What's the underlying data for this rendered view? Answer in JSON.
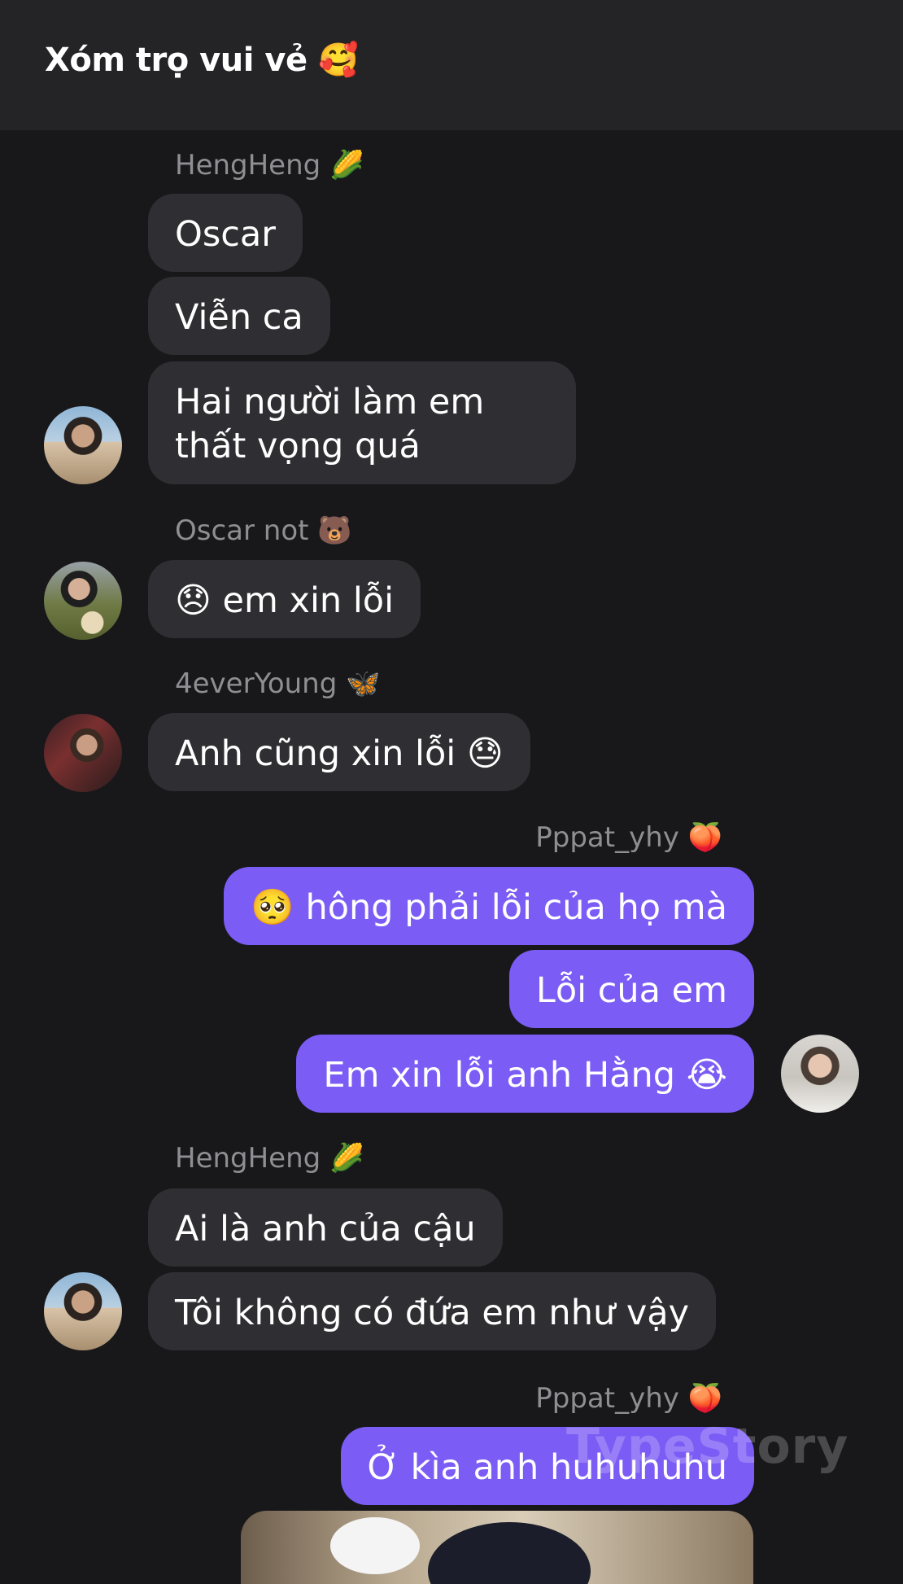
{
  "header": {
    "title": "Xóm trọ vui vẻ 🥰"
  },
  "messages": [
    {
      "sender": "HengHeng 🌽",
      "bubbles": [
        "Oscar",
        "Viễn ca",
        "Hai người làm em thất vọng quá"
      ]
    },
    {
      "sender": "Oscar not 🐻",
      "bubbles": [
        "😞 em xin lỗi"
      ]
    },
    {
      "sender": "4everYoung 🦋",
      "bubbles": [
        "Anh cũng xin lỗi 😓"
      ]
    },
    {
      "sender": "Pppat_yhy 🍑",
      "bubbles": [
        "🥺 hông phải lỗi của họ mà",
        "Lỗi của em",
        "Em xin lỗi anh Hằng 😭"
      ]
    },
    {
      "sender": "HengHeng 🌽",
      "bubbles": [
        "Ai là anh của cậu",
        "Tôi không có đứa em như vậy"
      ]
    },
    {
      "sender": "Pppat_yhy 🍑",
      "bubbles": [
        "Ở kìa anh huhuhuhu"
      ]
    }
  ],
  "watermark": "TypeStory"
}
